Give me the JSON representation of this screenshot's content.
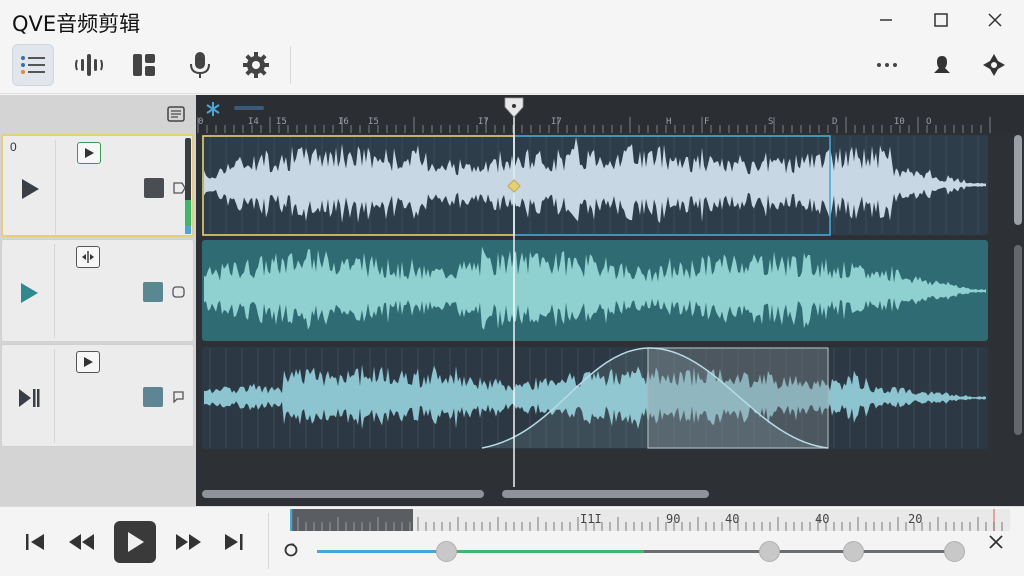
{
  "app": {
    "title": "QVE音频剪辑"
  },
  "window_controls": {
    "minimize": "minimize",
    "maximize": "maximize",
    "close": "close"
  },
  "toolbar": {
    "left_tools": [
      "list-icon",
      "waveform-icon",
      "layout-icon",
      "microphone-icon",
      "gear-icon"
    ],
    "right_tools": [
      "more-icon",
      "user-icon",
      "sparkle-icon"
    ],
    "active_tool": "list-icon"
  },
  "tracks": [
    {
      "index_label": "0",
      "color": "#3e4147",
      "selected": true
    },
    {
      "index_label": "",
      "color": "#5a8892",
      "selected": false
    },
    {
      "index_label": "",
      "color": "#5d8593",
      "selected": false
    }
  ],
  "ruler": {
    "labels": [
      "0",
      "I4",
      "I5",
      "I6",
      "I5",
      "I7",
      "I7",
      "H",
      "F",
      "S",
      "D",
      "I0",
      "O"
    ]
  },
  "mini_ruler": {
    "labels": [
      "I1I",
      "90",
      "40",
      "40",
      "20"
    ]
  },
  "colors": {
    "selection_yellow": "#e6cf74",
    "selection_blue": "#4aa6d8",
    "track2_bg": "#2f6b72",
    "playhead": "#ffffff",
    "progress_blue": "#4aa6d8",
    "progress_green": "#3fb86b"
  },
  "progress": {
    "played_fraction": 0.32,
    "green_end_fraction": 0.5
  }
}
